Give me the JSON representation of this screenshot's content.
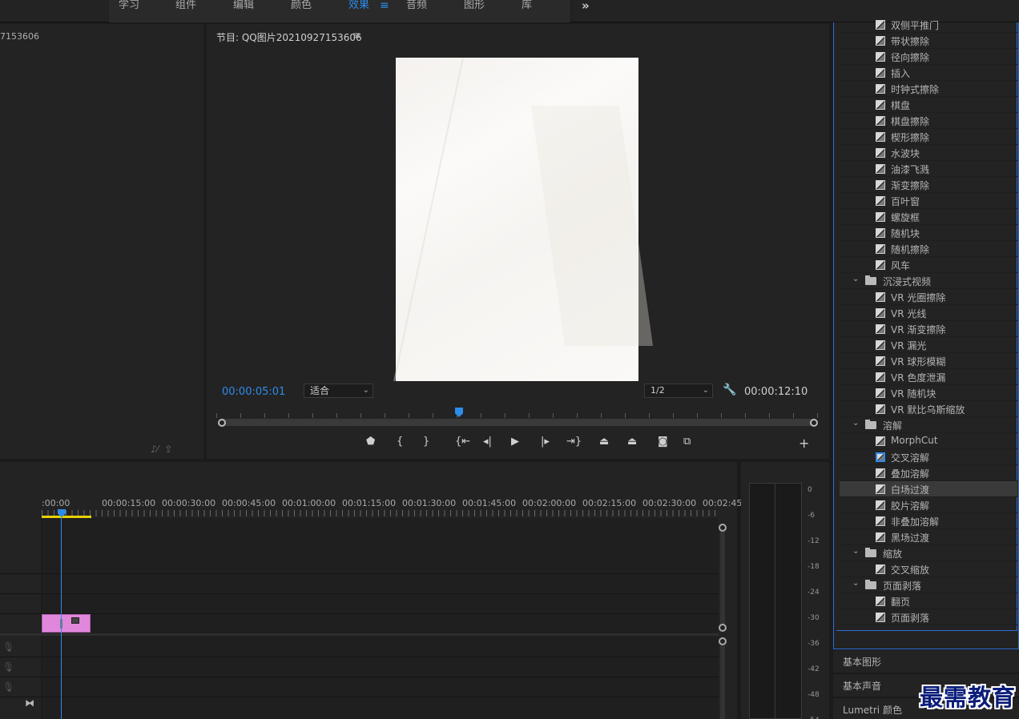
{
  "workspaces": {
    "tabs": [
      "学习",
      "组件",
      "编辑",
      "颜色",
      "效果",
      "音频",
      "图形",
      "库"
    ],
    "active": "效果",
    "more_icon": "double-chevron-right-icon"
  },
  "source_panel": {
    "title": "7153606"
  },
  "program_monitor": {
    "title": "节目: QQ图片20210927153606",
    "menu_icon": "≡",
    "current_timecode": "00:00:05:01",
    "fit_value": "适合",
    "resolution_value": "1/2",
    "duration_timecode": "00:00:12:10"
  },
  "effects_panel": {
    "items": [
      {
        "type": "item",
        "label": "双侧平推门"
      },
      {
        "type": "item",
        "label": "带状擦除"
      },
      {
        "type": "item",
        "label": "径向擦除"
      },
      {
        "type": "item",
        "label": "插入"
      },
      {
        "type": "item",
        "label": "时钟式擦除"
      },
      {
        "type": "item",
        "label": "棋盘"
      },
      {
        "type": "item",
        "label": "棋盘擦除"
      },
      {
        "type": "item",
        "label": "楔形擦除"
      },
      {
        "type": "item",
        "label": "水波块"
      },
      {
        "type": "item",
        "label": "油漆飞溅"
      },
      {
        "type": "item",
        "label": "渐变擦除"
      },
      {
        "type": "item",
        "label": "百叶窗"
      },
      {
        "type": "item",
        "label": "螺旋框"
      },
      {
        "type": "item",
        "label": "随机块"
      },
      {
        "type": "item",
        "label": "随机擦除"
      },
      {
        "type": "item",
        "label": "风车"
      },
      {
        "type": "folder",
        "label": "沉浸式视频"
      },
      {
        "type": "item",
        "label": "VR 光圈擦除"
      },
      {
        "type": "item",
        "label": "VR 光线"
      },
      {
        "type": "item",
        "label": "VR 渐变擦除"
      },
      {
        "type": "item",
        "label": "VR 漏光"
      },
      {
        "type": "item",
        "label": "VR 球形模糊"
      },
      {
        "type": "item",
        "label": "VR 色度泄漏"
      },
      {
        "type": "item",
        "label": "VR 随机块"
      },
      {
        "type": "item",
        "label": "VR 默比乌斯缩放"
      },
      {
        "type": "folder",
        "label": "溶解"
      },
      {
        "type": "item",
        "label": "MorphCut"
      },
      {
        "type": "item",
        "label": "交叉溶解",
        "highlight_icon": true
      },
      {
        "type": "item",
        "label": "叠加溶解"
      },
      {
        "type": "item",
        "label": "白场过渡",
        "selected": true
      },
      {
        "type": "item",
        "label": "胶片溶解"
      },
      {
        "type": "item",
        "label": "非叠加溶解"
      },
      {
        "type": "item",
        "label": "黑场过渡"
      },
      {
        "type": "folder",
        "label": "缩放"
      },
      {
        "type": "item",
        "label": "交叉缩放"
      },
      {
        "type": "folder",
        "label": "页面剥落"
      },
      {
        "type": "item",
        "label": "翻页"
      },
      {
        "type": "item",
        "label": "页面剥落"
      }
    ],
    "sections": [
      "基本图形",
      "基本声音",
      "Lumetri 颜色"
    ]
  },
  "timeline": {
    "ruler_labels": [
      ":00:00",
      "00:00:15:00",
      "00:00:30:00",
      "00:00:45:00",
      "00:01:00:00",
      "00:01:15:00",
      "00:01:30:00",
      "00:01:45:00",
      "00:02:00:00",
      "00:02:15:00",
      "00:02:30:00",
      "00:02:45:0"
    ],
    "clip_color": "#e087dc"
  },
  "audio_meter": {
    "labels": [
      "0",
      "-6",
      "-12",
      "-18",
      "-24",
      "-30",
      "-36",
      "-42",
      "-48",
      "-54"
    ]
  },
  "watermark": "最需教育",
  "colors": {
    "accent": "#2d8ceb",
    "work_area": "#e6d200"
  }
}
